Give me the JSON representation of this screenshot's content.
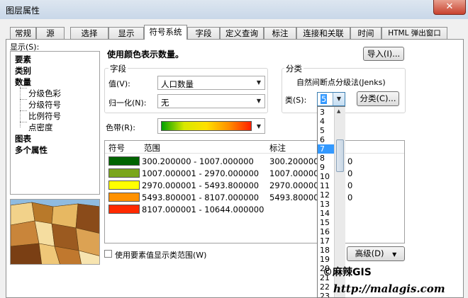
{
  "window": {
    "title": "图层属性",
    "close_glyph": "✕"
  },
  "tabs": [
    {
      "label": "常规"
    },
    {
      "label": "源"
    },
    {
      "label": "选择"
    },
    {
      "label": "显示"
    },
    {
      "label": "符号系统",
      "active": true
    },
    {
      "label": "字段"
    },
    {
      "label": "定义查询"
    },
    {
      "label": "标注"
    },
    {
      "label": "连接和关联"
    },
    {
      "label": "时间"
    },
    {
      "label": "HTML 弹出窗口"
    }
  ],
  "show_panel": {
    "label": "显示(S):",
    "items": [
      {
        "label": "要素",
        "bold": true
      },
      {
        "label": "类别",
        "bold": true
      },
      {
        "label": "数量",
        "bold": true
      },
      {
        "label": "分级色彩",
        "sub": true
      },
      {
        "label": "分级符号",
        "sub": true
      },
      {
        "label": "比例符号",
        "sub": true
      },
      {
        "label": "点密度",
        "sub": true
      },
      {
        "label": "图表",
        "bold": true
      },
      {
        "label": "多个属性",
        "bold": true
      }
    ]
  },
  "heading": "使用颜色表示数量。",
  "import_button": "导入(I)...",
  "fields_group": {
    "title": "字段",
    "value_label": "值(V):",
    "value_selected": "人口数量",
    "normalize_label": "归一化(N):",
    "normalize_selected": "无"
  },
  "classification_group": {
    "title": "分类",
    "method": "自然间断点分级法(Jenks)",
    "classes_label": "类(S):",
    "classes_value": "5",
    "classify_button": "分类(C)..."
  },
  "color_ramp_label": "色带(R):",
  "color_ramp_colors": [
    "#00a000",
    "#d8e800",
    "#ffe000",
    "#ff9000",
    "#ff2000"
  ],
  "table": {
    "headers": [
      "符号",
      "范围",
      "标注"
    ],
    "rows": [
      {
        "color": "#006400",
        "range": "300.200000 - 1007.000000",
        "label": "300.200000 - "
      },
      {
        "color": "#7aa61c",
        "range": "1007.000001 - 2970.000000",
        "label": "1007.000001 - "
      },
      {
        "color": "#ffff00",
        "range": "2970.000001 - 5493.800000",
        "label": "2970.000001 - "
      },
      {
        "color": "#ff9100",
        "range": "5493.800001 - 8107.000000",
        "label": "5493.800001 - "
      },
      {
        "color": "#ff2a00",
        "range": "8107.000001 - 10644.000000",
        "label": "8107.000001 - "
      }
    ],
    "label_suffixes": [
      "0",
      "0",
      "0",
      "0"
    ]
  },
  "dropdown_options": [
    "3",
    "4",
    "5",
    "6",
    "7",
    "8",
    "9",
    "10",
    "11",
    "12",
    "13",
    "14",
    "15",
    "16",
    "17",
    "18",
    "19",
    "20",
    "21",
    "22",
    "23"
  ],
  "dropdown_selected": "7",
  "show_class_ranges_checkbox": "使用要素值显示类范围(W)",
  "advanced_button": "高级(D)",
  "watermark": {
    "line1": "©麻辣GIS",
    "line2": "http://malagis.com"
  }
}
